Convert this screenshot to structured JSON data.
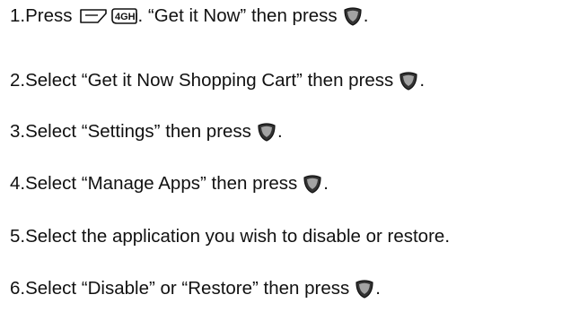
{
  "steps": [
    {
      "number": "1.",
      "before": " Press",
      "middle": ". “Get it Now” then press",
      "end": ".",
      "key4_label": "4GHI"
    },
    {
      "number": "2.",
      "text": " Select “Get it Now Shopping Cart” then press",
      "end": "."
    },
    {
      "number": "3.",
      "text": " Select “Settings” then press",
      "end": "."
    },
    {
      "number": "4.",
      "text": " Select “Manage Apps” then press",
      "end": "."
    },
    {
      "number": "5.",
      "text": " Select the application you wish to disable or restore."
    },
    {
      "number": "6.",
      "text": " Select “Disable” or “Restore” then press",
      "end": "."
    }
  ],
  "icons": {
    "menu_key": "menu-key-icon",
    "key4": "key-4-icon",
    "ok_key": "ok-key-icon"
  }
}
